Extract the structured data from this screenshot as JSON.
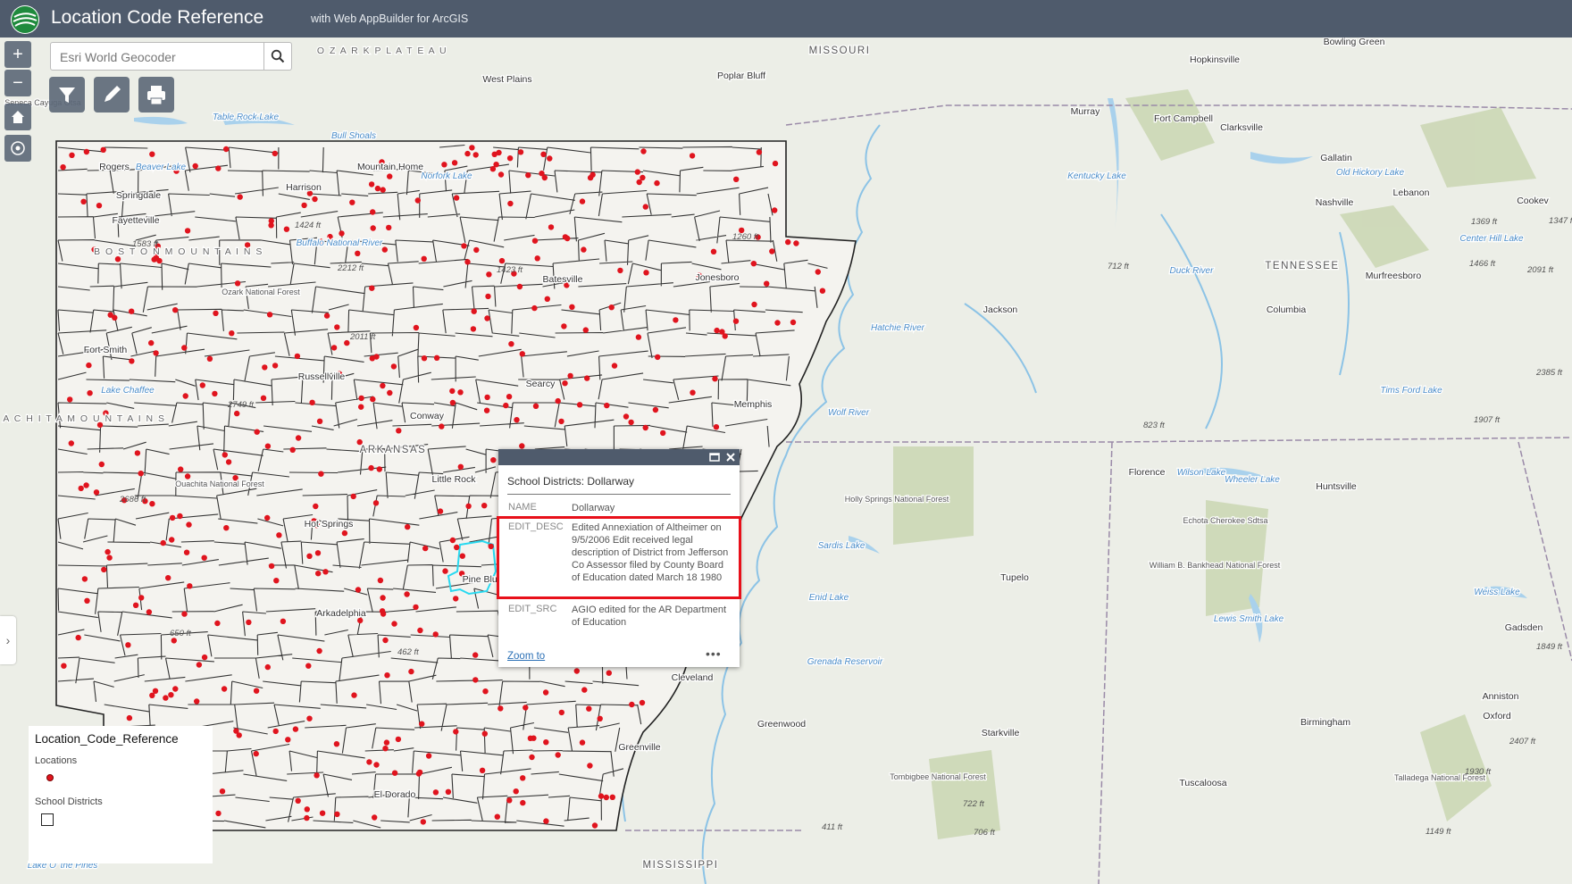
{
  "header": {
    "title": "Location Code Reference",
    "subtitle": "with Web AppBuilder for ArcGIS"
  },
  "search": {
    "placeholder": "Esri World Geocoder"
  },
  "map": {
    "labels": [
      {
        "text": "O Z A R K   P L A T E A U",
        "kind": "region"
      },
      {
        "text": "MISSOURI",
        "kind": "state"
      },
      {
        "text": "West Plains",
        "kind": "city"
      },
      {
        "text": "Poplar Bluff",
        "kind": "city"
      },
      {
        "text": "Murray",
        "kind": "city"
      },
      {
        "text": "Hopkinsville",
        "kind": "city"
      },
      {
        "text": "Bowling Green",
        "kind": "city"
      },
      {
        "text": "Fort Campbell",
        "kind": "city"
      },
      {
        "text": "Clarksville",
        "kind": "city"
      },
      {
        "text": "Gallatin",
        "kind": "city"
      },
      {
        "text": "Nashville",
        "kind": "city"
      },
      {
        "text": "Lebanon",
        "kind": "city"
      },
      {
        "text": "Cookev",
        "kind": "city"
      },
      {
        "text": "Kentucky Lake",
        "kind": "water"
      },
      {
        "text": "Old Hickory Lake",
        "kind": "water"
      },
      {
        "text": "TENNESSEE",
        "kind": "state"
      },
      {
        "text": "Murfreesboro",
        "kind": "city"
      },
      {
        "text": "Center Hill Lake",
        "kind": "water"
      },
      {
        "text": "Columbia",
        "kind": "city"
      },
      {
        "text": "Jackson",
        "kind": "city"
      },
      {
        "text": "Duck River",
        "kind": "water"
      },
      {
        "text": "Hatchie River",
        "kind": "water"
      },
      {
        "text": "Memphis",
        "kind": "city"
      },
      {
        "text": "Wolf River",
        "kind": "water"
      },
      {
        "text": "Tims Ford Lake",
        "kind": "water"
      },
      {
        "text": "Florence",
        "kind": "city"
      },
      {
        "text": "Wilson Lake",
        "kind": "water"
      },
      {
        "text": "Wheeler Lake",
        "kind": "water"
      },
      {
        "text": "Huntsville",
        "kind": "city"
      },
      {
        "text": "Holly Springs National Forest",
        "kind": "park"
      },
      {
        "text": "Echota Cherokee Sdtsa",
        "kind": "park"
      },
      {
        "text": "William B. Bankhead National Forest",
        "kind": "park"
      },
      {
        "text": "Sardis Lake",
        "kind": "water"
      },
      {
        "text": "Tupelo",
        "kind": "city"
      },
      {
        "text": "Enid Lake",
        "kind": "water"
      },
      {
        "text": "Grenada Reservoir",
        "kind": "water"
      },
      {
        "text": "Lewis Smith Lake",
        "kind": "water"
      },
      {
        "text": "Weiss Lake",
        "kind": "water"
      },
      {
        "text": "Gadsden",
        "kind": "city"
      },
      {
        "text": "Anniston",
        "kind": "city"
      },
      {
        "text": "Oxford",
        "kind": "city"
      },
      {
        "text": "Birmingham",
        "kind": "city"
      },
      {
        "text": "Cleveland",
        "kind": "city"
      },
      {
        "text": "Greenwood",
        "kind": "city"
      },
      {
        "text": "Greenville",
        "kind": "city"
      },
      {
        "text": "Starkville",
        "kind": "city"
      },
      {
        "text": "Tuscaloosa",
        "kind": "city"
      },
      {
        "text": "Tombigbee National Forest",
        "kind": "park"
      },
      {
        "text": "Talladega National Forest",
        "kind": "park"
      },
      {
        "text": "MISSISSIPPI",
        "kind": "state"
      },
      {
        "text": "Springdale",
        "kind": "city"
      },
      {
        "text": "Fayetteville",
        "kind": "city"
      },
      {
        "text": "Rogers",
        "kind": "city"
      },
      {
        "text": "Beaver Lake",
        "kind": "water"
      },
      {
        "text": "Harrison",
        "kind": "city"
      },
      {
        "text": "Mountain Home",
        "kind": "city"
      },
      {
        "text": "Norfork Lake",
        "kind": "water"
      },
      {
        "text": "Buffalo National River",
        "kind": "water"
      },
      {
        "text": "B O S T O N   M O U N T A I N S",
        "kind": "region"
      },
      {
        "text": "Ozark National Forest",
        "kind": "park"
      },
      {
        "text": "Batesville",
        "kind": "city"
      },
      {
        "text": "Jonesboro",
        "kind": "city"
      },
      {
        "text": "Fort Smith",
        "kind": "city"
      },
      {
        "text": "Russellville",
        "kind": "city"
      },
      {
        "text": "Searcy",
        "kind": "city"
      },
      {
        "text": "Conway",
        "kind": "city"
      },
      {
        "text": "Little Rock",
        "kind": "city"
      },
      {
        "text": "ARKANSAS",
        "kind": "state"
      },
      {
        "text": "Ouachita National Forest",
        "kind": "park"
      },
      {
        "text": "Hot Springs",
        "kind": "city"
      },
      {
        "text": "Arkadelphia",
        "kind": "city"
      },
      {
        "text": "Pine Bluff",
        "kind": "city"
      },
      {
        "text": "El Dorado",
        "kind": "city"
      },
      {
        "text": "U A C H I T A   M O U N T A I N S",
        "kind": "region"
      },
      {
        "text": "Lake Chaffee",
        "kind": "water"
      },
      {
        "text": "Table Rock Lake",
        "kind": "water"
      },
      {
        "text": "Bull Shoals",
        "kind": "water"
      },
      {
        "text": "Seneca Cayuga Otsa",
        "kind": "park"
      },
      {
        "text": "Lake O' the Pines",
        "kind": "water"
      }
    ],
    "elevations": [
      "1369 ft",
      "1347 ft",
      "1466 ft",
      "2091 ft",
      "712 ft",
      "2385 ft",
      "1907 ft",
      "823 ft",
      "1849 ft",
      "2407 ft",
      "1930 ft",
      "1149 ft",
      "722 ft",
      "706 ft",
      "411 ft",
      "2212 ft",
      "1423 ft",
      "2011 ft",
      "2749 ft",
      "2686 ft",
      "650 ft",
      "462 ft",
      "1260 ft",
      "1424 ft",
      "1583 ft"
    ],
    "location_point_count": 370
  },
  "popup": {
    "title": "School Districts: Dollarway",
    "fields": [
      {
        "key": "NAME",
        "value": "Dollarway"
      },
      {
        "key": "EDIT_DESC",
        "value": "Edited Annexiation of Altheimer on 9/5/2006 Edit received legal description of District from Jefferson Co Assessor filed by County Board of Education dated March 18 1980"
      },
      {
        "key": "EDIT_SRC",
        "value": "AGIO edited for the AR Department of Education"
      }
    ],
    "zoom_label": "Zoom to",
    "more_label": "•••"
  },
  "legend": {
    "title": "Location_Code_Reference",
    "layers": [
      "Locations",
      "School Districts"
    ]
  },
  "colors": {
    "header_bg": "#4f5b6c",
    "location_point": "#e0141e",
    "highlight": "#e8101a",
    "selected_district": "#27d9f0"
  }
}
